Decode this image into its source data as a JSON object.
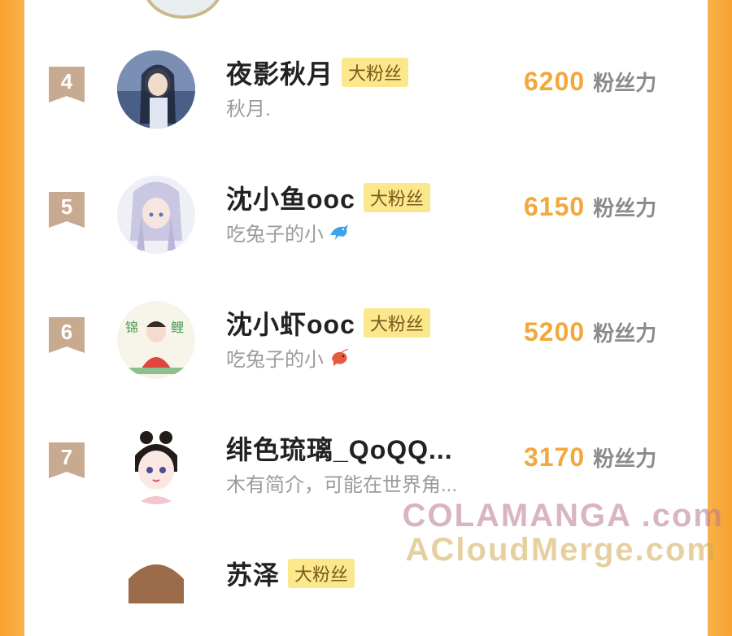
{
  "rows": [
    {
      "rank": "4",
      "name": "夜影秋月",
      "badge": "大粉丝",
      "bio": "秋月.",
      "score": "6200",
      "unit": "粉丝力"
    },
    {
      "rank": "5",
      "name": "沈小鱼ooc",
      "badge": "大粉丝",
      "bio": "吃兔子的小",
      "bio_icon": "dolphin-icon",
      "score": "6150",
      "unit": "粉丝力"
    },
    {
      "rank": "6",
      "name": "沈小虾ooc",
      "badge": "大粉丝",
      "bio": "吃兔子的小",
      "bio_icon": "shrimp-icon",
      "score": "5200",
      "unit": "粉丝力"
    },
    {
      "rank": "7",
      "name": "绯色琉璃_QoQQ...",
      "badge": "",
      "bio": "木有简介，可能在世界角...",
      "score": "3170",
      "unit": "粉丝力"
    },
    {
      "rank": "",
      "name": "苏泽",
      "badge": "大粉丝",
      "bio": "",
      "score": "",
      "unit": ""
    }
  ],
  "watermark": {
    "line1": "COLAMANGA .com",
    "line2": "ACloudMerge.com"
  },
  "colors": {
    "accent_orange": "#f2a83d",
    "badge_bg": "#fbe88d",
    "rank_bg": "#c7aa90"
  }
}
